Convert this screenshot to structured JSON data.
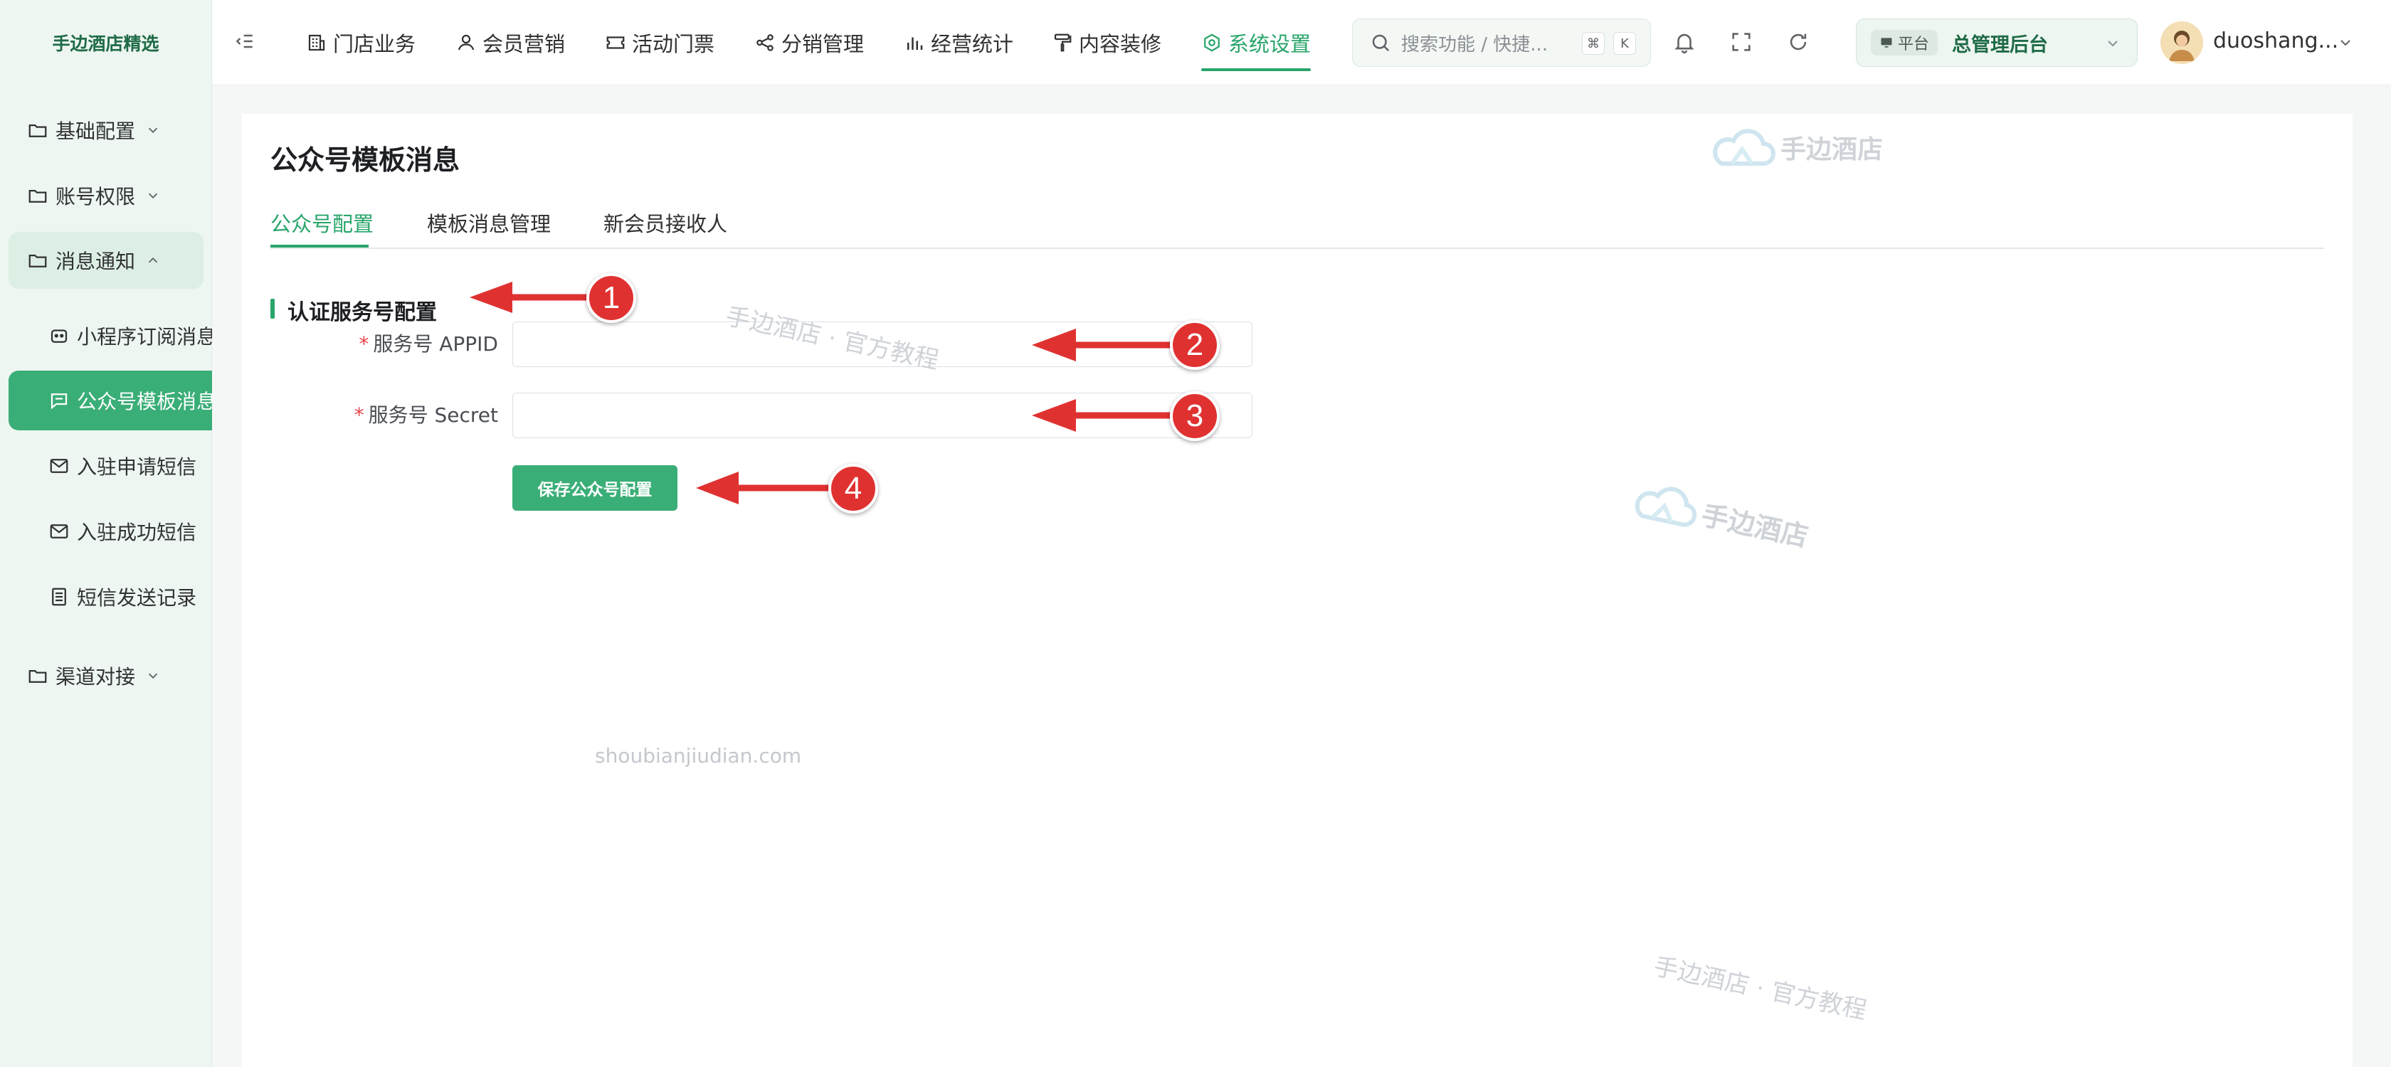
{
  "sidebar": {
    "brand": "手边酒店精选",
    "menus": [
      {
        "label": "基础配置",
        "icon": "folder-icon",
        "chevron": "chevron-down-icon"
      },
      {
        "label": "账号权限",
        "icon": "folder-icon",
        "chevron": "chevron-down-icon"
      },
      {
        "label": "消息通知",
        "icon": "folder-icon",
        "chevron": "chevron-up-icon"
      },
      {
        "label": "渠道对接",
        "icon": "folder-icon",
        "chevron": "chevron-down-icon"
      }
    ],
    "sub_items": [
      {
        "label": "小程序订阅消息",
        "icon": "robot-icon"
      },
      {
        "label": "公众号模板消息",
        "icon": "message-icon",
        "active": true
      },
      {
        "label": "入驻申请短信",
        "icon": "mail-icon"
      },
      {
        "label": "入驻成功短信",
        "icon": "mail-icon"
      },
      {
        "label": "短信发送记录",
        "icon": "list-icon"
      }
    ]
  },
  "topbar": {
    "tabs": [
      {
        "label": "门店业务",
        "icon": "building-icon"
      },
      {
        "label": "会员营销",
        "icon": "user-icon"
      },
      {
        "label": "活动门票",
        "icon": "ticket-icon"
      },
      {
        "label": "分销管理",
        "icon": "share-icon"
      },
      {
        "label": "经营统计",
        "icon": "bar-chart-icon"
      },
      {
        "label": "内容装修",
        "icon": "paint-roller-icon"
      },
      {
        "label": "系统设置",
        "icon": "gear-icon",
        "active": true
      }
    ],
    "search_placeholder": "搜索功能 / 快捷...",
    "shortcut_keys": [
      "⌘",
      "K"
    ],
    "org_badge": "平台",
    "org_name": "总管理后台",
    "user_name": "duoshang..."
  },
  "content": {
    "page_title": "公众号模板消息",
    "sub_tabs": [
      "公众号配置",
      "模板消息管理",
      "新会员接收人"
    ],
    "active_sub_tab": 0,
    "section_title": "认证服务号配置",
    "fields": [
      {
        "label": "服务号 APPID",
        "required": true,
        "value": ""
      },
      {
        "label": "服务号 Secret",
        "required": true,
        "value": ""
      }
    ],
    "save_button": "保存公众号配置"
  },
  "watermarks": {
    "logo_text": "手边酒店",
    "tutorial_text": "手边酒店 · 官方教程",
    "domain_text": "shoubianjiudian.com"
  },
  "annotations": [
    "1",
    "2",
    "3",
    "4"
  ],
  "colors": {
    "accent": "#28a56a",
    "active_bg": "#3aae77",
    "sidebar_bg": "#eef6f1",
    "annotation": "#e03131",
    "required": "#e5484d"
  }
}
